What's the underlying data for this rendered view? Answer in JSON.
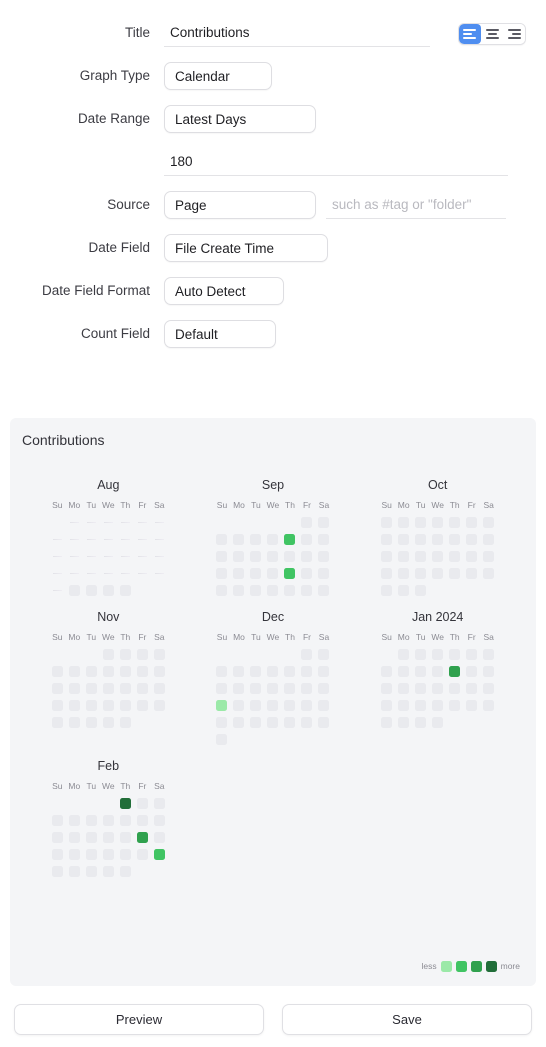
{
  "form": {
    "rows": [
      {
        "label": "Title",
        "value": "Contributions",
        "style": "underline"
      },
      {
        "label": "Graph Type",
        "value": "Calendar",
        "style": "boxed"
      },
      {
        "label": "Date Range",
        "value": "Latest Days",
        "style": "boxed"
      },
      {
        "label": "",
        "value": "180",
        "style": "underline"
      },
      {
        "label": "Source",
        "value": "Page",
        "style": "boxed"
      },
      {
        "label": "Date Field",
        "value": "File Create Time",
        "style": "boxed"
      },
      {
        "label": "Date Field Format",
        "value": "Auto Detect",
        "style": "boxed"
      },
      {
        "label": "Count Field",
        "value": "Default",
        "style": "boxed"
      }
    ],
    "source_query_placeholder": "such as #tag or \"folder\"",
    "source_query_value": ""
  },
  "align_toolbar": {
    "options": [
      {
        "name": "align-left",
        "selected": true
      },
      {
        "name": "align-center",
        "selected": false
      },
      {
        "name": "align-right",
        "selected": false
      }
    ],
    "active_color": "#4f8ef0"
  },
  "preview": {
    "title": "Contributions",
    "legend": {
      "less_label": "less",
      "more_label": "more",
      "swatches": [
        "#9be9a8",
        "#40c463",
        "#30a14e",
        "#216e39"
      ]
    },
    "weekday_labels": [
      "Su",
      "Mo",
      "Tu",
      "We",
      "Th",
      "Fr",
      "Sa"
    ],
    "levels": {
      "0": "#e9eaee",
      "1": "#9be9a8",
      "2": "#40c463",
      "3": "#30a14e",
      "4": "#216e39"
    },
    "months": [
      {
        "name": "Aug",
        "cells": [
          "x",
          "tick",
          "tick",
          "tick",
          "tick",
          "tick",
          "tick",
          "tick",
          "tick",
          "tick",
          "tick",
          "tick",
          "tick",
          "tick",
          "tick",
          "tick",
          "tick",
          "tick",
          "tick",
          "tick",
          "tick",
          "tick",
          "tick",
          "tick",
          "tick",
          "tick",
          "tick",
          "tick",
          "tick",
          "0",
          "0",
          "0",
          "0",
          "x",
          "x"
        ]
      },
      {
        "name": "Sep",
        "cells": [
          "x",
          "x",
          "x",
          "x",
          "x",
          "0",
          "0",
          "0",
          "0",
          "0",
          "0",
          "2",
          "0",
          "0",
          "0",
          "0",
          "0",
          "0",
          "0",
          "0",
          "0",
          "0",
          "0",
          "0",
          "0",
          "2",
          "0",
          "0",
          "0",
          "0",
          "0",
          "0",
          "0",
          "0",
          "0"
        ]
      },
      {
        "name": "Oct",
        "cells": [
          "0",
          "0",
          "0",
          "0",
          "0",
          "0",
          "0",
          "0",
          "0",
          "0",
          "0",
          "0",
          "0",
          "0",
          "0",
          "0",
          "0",
          "0",
          "0",
          "0",
          "0",
          "0",
          "0",
          "0",
          "0",
          "0",
          "0",
          "0",
          "0",
          "0",
          "0",
          "x",
          "x",
          "x",
          "x"
        ]
      },
      {
        "name": "Nov",
        "cells": [
          "x",
          "x",
          "x",
          "0",
          "0",
          "0",
          "0",
          "0",
          "0",
          "0",
          "0",
          "0",
          "0",
          "0",
          "0",
          "0",
          "0",
          "0",
          "0",
          "0",
          "0",
          "0",
          "0",
          "0",
          "0",
          "0",
          "0",
          "0",
          "0",
          "0",
          "0",
          "0",
          "0",
          "x",
          "x"
        ]
      },
      {
        "name": "Dec",
        "cells": [
          "x",
          "x",
          "x",
          "x",
          "x",
          "0",
          "0",
          "0",
          "0",
          "0",
          "0",
          "0",
          "0",
          "0",
          "0",
          "0",
          "0",
          "0",
          "0",
          "0",
          "0",
          "1",
          "0",
          "0",
          "0",
          "0",
          "0",
          "0",
          "0",
          "0",
          "0",
          "0",
          "0",
          "0",
          "0",
          "0",
          "x",
          "x",
          "x",
          "x",
          "x",
          "x"
        ]
      },
      {
        "name": "Jan 2024",
        "cells": [
          "x",
          "0",
          "0",
          "0",
          "0",
          "0",
          "0",
          "0",
          "0",
          "0",
          "0",
          "3",
          "0",
          "0",
          "0",
          "0",
          "0",
          "0",
          "0",
          "0",
          "0",
          "0",
          "0",
          "0",
          "0",
          "0",
          "0",
          "0",
          "0",
          "0",
          "0",
          "0",
          "x",
          "x",
          "x"
        ]
      },
      {
        "name": "Feb",
        "cells": [
          "x",
          "x",
          "x",
          "x",
          "4",
          "0",
          "0",
          "0",
          "0",
          "0",
          "0",
          "0",
          "0",
          "0",
          "0",
          "0",
          "0",
          "0",
          "0",
          "3",
          "0",
          "0",
          "0",
          "0",
          "0",
          "0",
          "0",
          "2",
          "0",
          "0",
          "0",
          "0",
          "0",
          "x",
          "x"
        ]
      }
    ]
  },
  "footer": {
    "preview_label": "Preview",
    "save_label": "Save"
  }
}
